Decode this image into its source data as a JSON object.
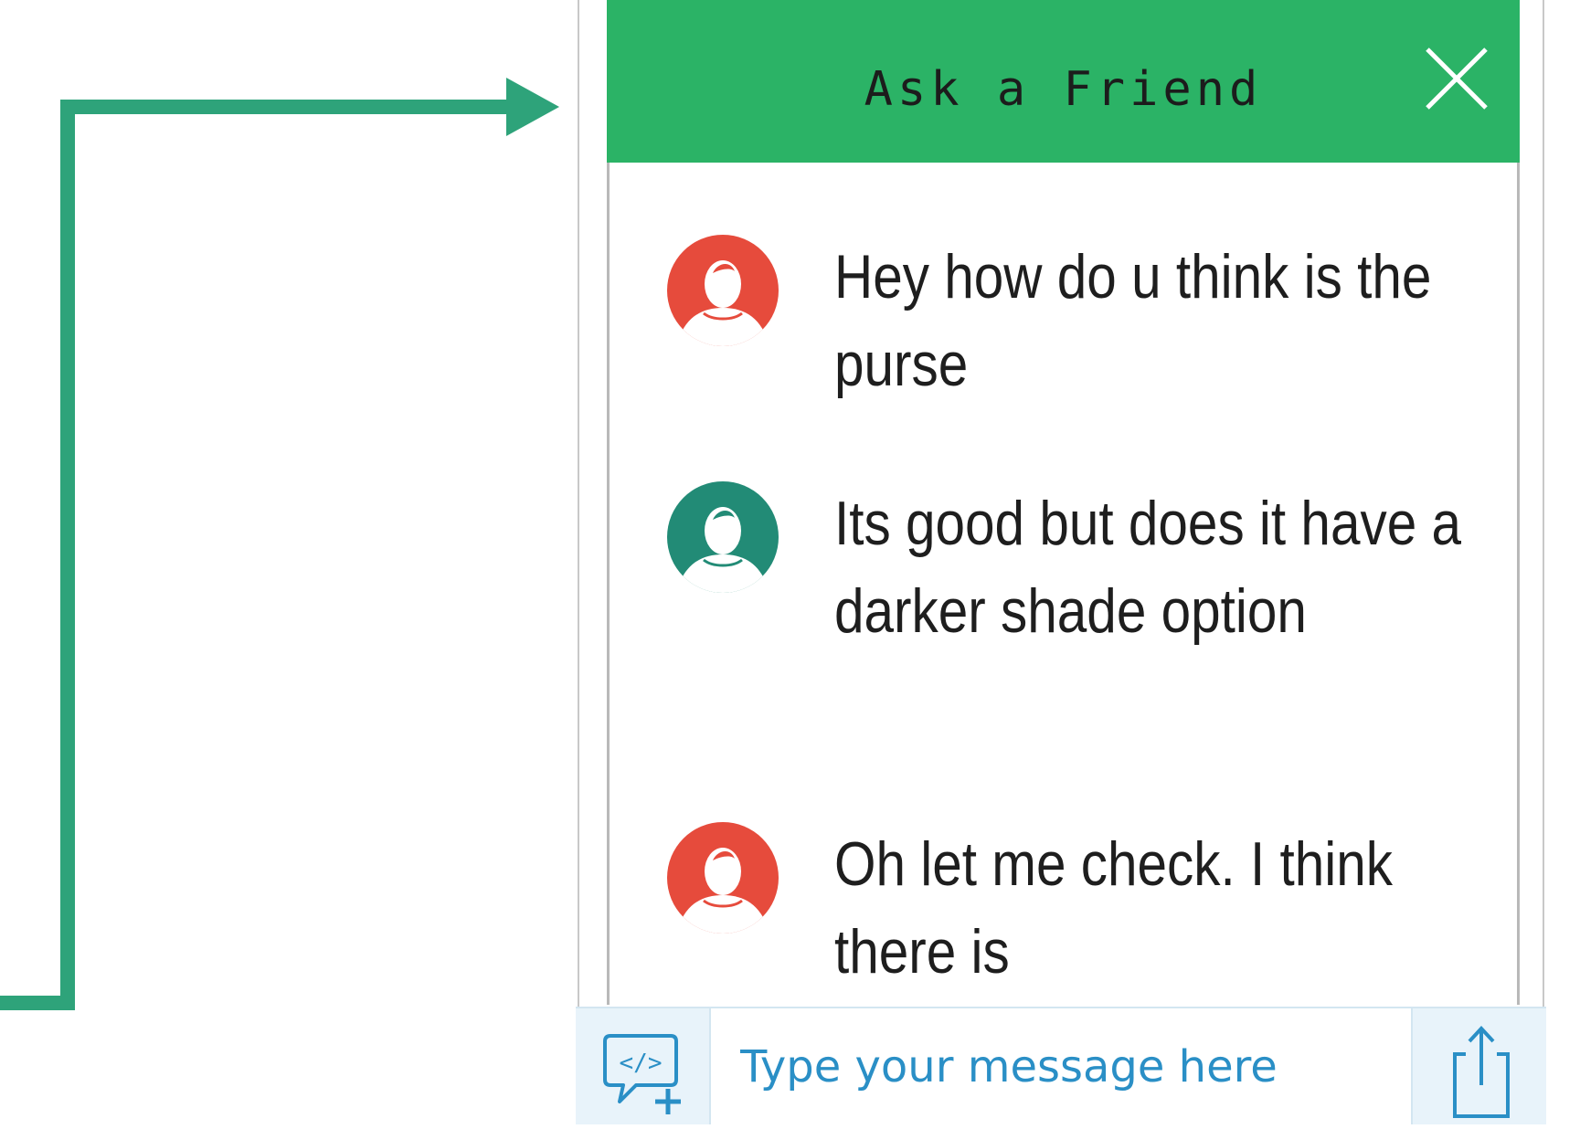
{
  "header": {
    "title": "Ask a Friend",
    "close_icon": "close-icon"
  },
  "messages": [
    {
      "sender": "friend",
      "avatar_color": "#e64b3c",
      "text": "Hey how do u think is the purse"
    },
    {
      "sender": "user",
      "avatar_color": "#228b76",
      "text": "Its good but does it have a darker shade option"
    },
    {
      "sender": "friend",
      "avatar_color": "#e64b3c",
      "text": "Oh let me check. I think there is"
    }
  ],
  "composer": {
    "placeholder": "Type your message here",
    "left_icon": "code-snippet-add-icon",
    "right_icon": "share-icon"
  },
  "colors": {
    "header_bg": "#2bb366",
    "connector": "#2ea37a",
    "composer_text": "#2a8fc6",
    "composer_bg": "#e8f3fa"
  }
}
